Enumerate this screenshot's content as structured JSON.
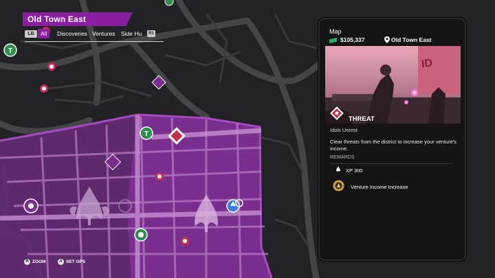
{
  "district": {
    "title": "Old Town East"
  },
  "filters": {
    "left_button": "LB",
    "tabs": [
      {
        "label": "All",
        "active": true
      },
      {
        "label": "Discoveries"
      },
      {
        "label": "Ventures"
      },
      {
        "label": "Side Hu"
      }
    ],
    "right_button": "R1"
  },
  "panel": {
    "title": "Map",
    "money": "$105,337",
    "location": "Old Town East",
    "activity_type": "THREAT",
    "activity_name": "Idols Unrest",
    "description": "Clear threats from the district to increase your venture's income.",
    "rewards_label": "REWARDS",
    "rewards": [
      {
        "icon": "xp-icon",
        "label": "XP 300"
      },
      {
        "icon": "venture-income-icon",
        "label": "Venture Income Increase"
      }
    ]
  },
  "controls": [
    {
      "button": "R",
      "label": "ZOOM"
    },
    {
      "button": "A",
      "label": "SET GPS"
    }
  ],
  "colors": {
    "accent": "#8a1fa0",
    "district": "#9a3bb0",
    "money": "#27b36a",
    "threat": "#c4304a"
  }
}
